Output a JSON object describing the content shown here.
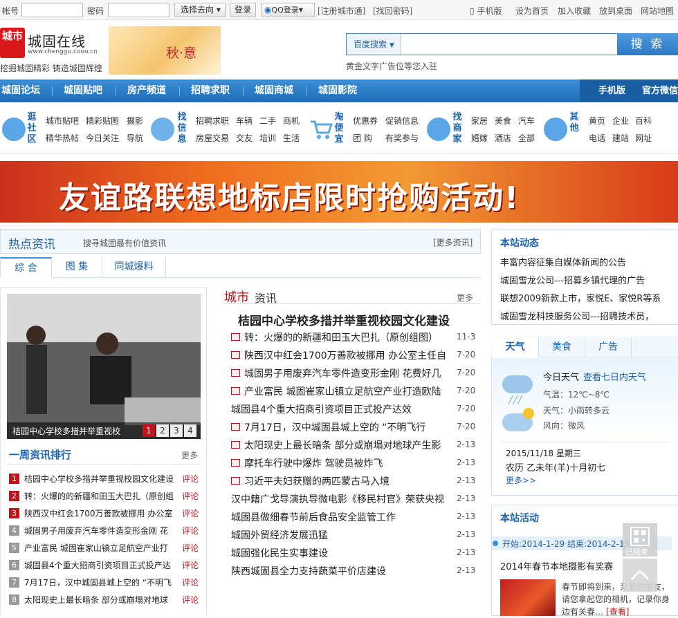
{
  "topbar": {
    "account_label": "帐号",
    "password_label": "密码",
    "goto_label": "选择去向",
    "login_button": "登录",
    "qq_login": "QQ登录",
    "register": "[注册城市通]",
    "recover": "[找回密码]",
    "mobile": "手机版",
    "set_home": "设为首页",
    "favorite": "加入收藏",
    "desktop": "放到桌面",
    "sitemap": "网站地图"
  },
  "header": {
    "logo_mark": "城市",
    "logo_name": "城固在线",
    "logo_url": "www.chenggu.cooo.cn",
    "slogan": "挖掘城固精彩 铸造城固辉煌",
    "season_banner": "秋·意",
    "search_engine": "百度搜索",
    "search_button": "搜 索",
    "ad_text": "黄金文字广告位等您入驻"
  },
  "nav": {
    "items": [
      "城固论坛",
      "城固贴吧",
      "房产频道",
      "招聘求职",
      "城固商城",
      "城固影院"
    ],
    "right": [
      "手机版",
      "官方微信"
    ]
  },
  "categories": [
    {
      "title": "逛社区",
      "links": [
        "城市贴吧",
        "精彩贴图",
        "摄影",
        "精华热帖",
        "今日关注",
        "导航"
      ]
    },
    {
      "title": "找信息",
      "links": [
        "招聘求职",
        "车辆",
        "二手",
        "商机",
        "房屋交易",
        "交友",
        "培训",
        "生活"
      ]
    },
    {
      "title": "淘便宜",
      "links": [
        "优惠券",
        "促销信息",
        "团 购",
        "有奖参与"
      ]
    },
    {
      "title": "找商家",
      "links": [
        "家居",
        "美食",
        "汽车",
        "婚嫁",
        "酒店",
        "全部"
      ]
    },
    {
      "title": "其他",
      "links": [
        "黄页",
        "企业",
        "百科",
        "电话",
        "建站",
        "网址"
      ]
    }
  ],
  "banner": {
    "text": "友谊路联想地标店限时抢购活动!"
  },
  "hot": {
    "title": "热点资讯",
    "subtitle": "搜寻城固最有价值资讯",
    "more": "[更多资讯]",
    "tabs": [
      "综 合",
      "图 集",
      "同城爆料"
    ]
  },
  "photo": {
    "caption": "桔园中心学校多措并举重视校",
    "pages": [
      "1",
      "2",
      "3",
      "4"
    ]
  },
  "ranking": {
    "title": "一周资讯排行",
    "more": "更多",
    "comment": "评论",
    "items": [
      "桔园中心学校多措并举重视校园文化建设",
      "转：火爆的的新疆和田玉大巴扎（原创组",
      "陕西汉中红会1700万善款被挪用 办公室",
      "城固男子用废弃汽车零件造変形金刚 花",
      "产业富民 城固崔家山镇立足航空产业打",
      "城固县4个重大招商引资项目正式投产达",
      "7月17日，汉中城固县城上空的 “不明飞",
      "太阳现史上最长暗条 部分或崩塌对地球"
    ]
  },
  "city_news": {
    "title_a": "城市",
    "title_b": "资讯",
    "more": "更多",
    "headline": "桔园中心学校多措并举重视校园文化建设",
    "items": [
      {
        "title": "转：火爆的的新疆和田玉大巴扎（原创组图）",
        "date": "11-3",
        "icon": true
      },
      {
        "title": "陕西汉中红会1700万善款被挪用 办公室主任自",
        "date": "7-20",
        "icon": true
      },
      {
        "title": "城固男子用废弃汽车零件造变形金刚 花费好几",
        "date": "7-20",
        "icon": true
      },
      {
        "title": "产业富民 城固崔家山镇立足航空产业打造欧陆",
        "date": "7-20",
        "icon": true
      },
      {
        "title": "城固县4个重大招商引资项目正式投产达效",
        "date": "7-20",
        "icon": false
      },
      {
        "title": "7月17日，汉中城固县城上空的 “不明飞行",
        "date": "7-20",
        "icon": true
      },
      {
        "title": "太阳现史上最长暗条 部分或崩塌对地球产生影",
        "date": "2-13",
        "icon": true
      },
      {
        "title": "摩托车行驶中爆炸 驾驶员被炸飞",
        "date": "2-13",
        "icon": true
      },
      {
        "title": "习近平夫妇获赠的两匹蒙古马入境",
        "date": "2-13",
        "icon": true
      },
      {
        "title": "汉中籍广戈导演执导微电影《移民村官》荣获央视",
        "date": "2-13",
        "icon": false
      },
      {
        "title": "城固县做细春节前后食品安全监管工作",
        "date": "2-13",
        "icon": false
      },
      {
        "title": "城固外贸经济发展迅猛",
        "date": "2-13",
        "icon": false
      },
      {
        "title": "城固强化民生实事建设",
        "date": "2-13",
        "icon": false
      },
      {
        "title": "陕西城固县全力支持蔬菜平价店建设",
        "date": "2-13",
        "icon": false
      }
    ]
  },
  "dynamics": {
    "title": "本站动态",
    "items": [
      "丰富内容征集自媒体新闻的公告",
      "城固雪龙公司---招募乡镇代理的广告",
      "联想2009新款上市，家悦E、家悦R等系",
      "城固雪龙科技服务公司---招聘技术员，"
    ]
  },
  "weather": {
    "tabs": [
      "天气",
      "美食",
      "广告"
    ],
    "today": "今日天气",
    "week_link": "查看七日内天气",
    "temp": "气温：12℃~8℃",
    "condition": "天气：小雨转多云",
    "wind": "风向：微风",
    "date": "2015/11/18 星期三",
    "lunar": "农历 乙未年(羊)十月初七",
    "more": "更多>>"
  },
  "activity": {
    "title": "本站活动",
    "date": "开始:2014-1-29 结束:2014-2-15",
    "status": "已结束",
    "name": "2014年春节本地摄影有奖赛",
    "desc": "春节即将到来，亲爱的朋友，请您拿起您的相机，记录你身边有关春…",
    "view": "[查看]"
  }
}
